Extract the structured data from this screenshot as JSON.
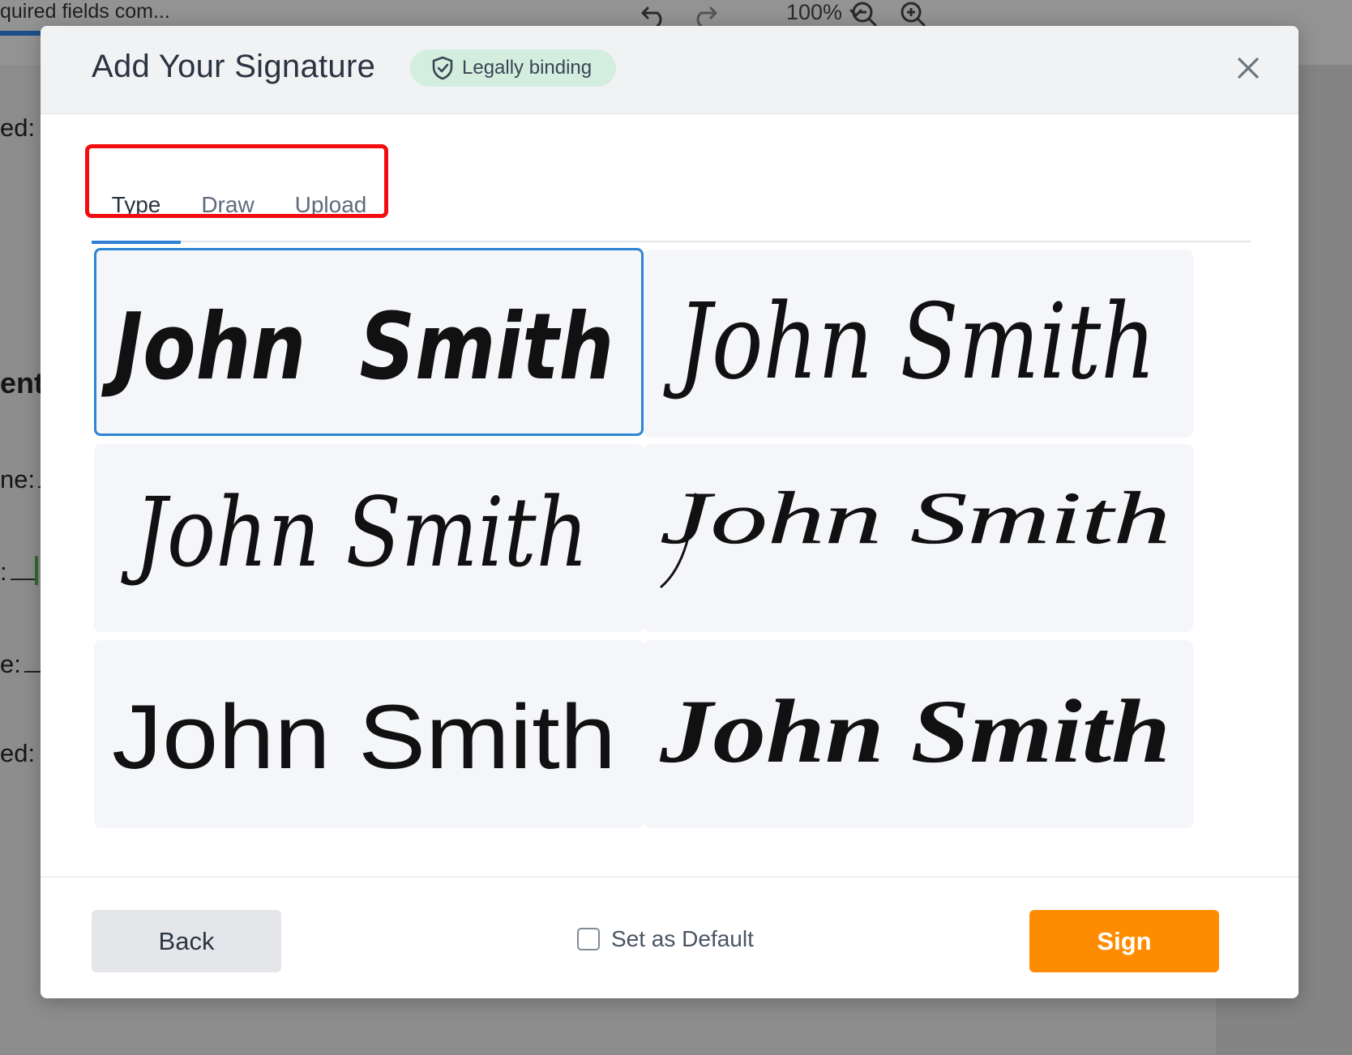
{
  "background": {
    "progress_text": "quired fields com...",
    "zoom_level": "100%",
    "labels": [
      "ed:",
      "ent",
      "ne:",
      ":",
      "e:",
      "ed:"
    ]
  },
  "modal": {
    "title": "Add Your Signature",
    "badge": "Legally binding",
    "tabs": [
      {
        "label": "Type",
        "active": true
      },
      {
        "label": "Draw",
        "active": false
      },
      {
        "label": "Upload",
        "active": false
      }
    ],
    "signatures": [
      {
        "text": "John  Smith",
        "selected": true
      },
      {
        "text": "John Smith",
        "selected": false
      },
      {
        "text": "John Smith",
        "selected": false
      },
      {
        "text": "John Smith",
        "selected": false
      },
      {
        "text": "John Smith",
        "selected": false
      },
      {
        "text": "John Smith",
        "selected": false
      }
    ],
    "footer": {
      "back_label": "Back",
      "default_label": "Set as Default",
      "default_checked": false,
      "sign_label": "Sign"
    }
  },
  "colors": {
    "accent_blue": "#2d86d3",
    "sign_orange": "#ff8c00",
    "badge_green": "#d3eedf",
    "highlight_red": "#f30d10"
  }
}
